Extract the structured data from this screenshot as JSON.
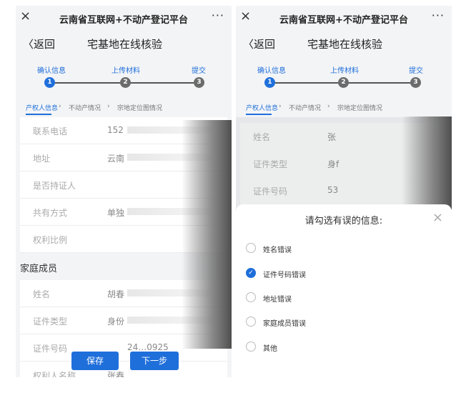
{
  "app": {
    "title": "云南省互联网+不动产登记平台",
    "close_icon": "×",
    "more_icon": "···"
  },
  "nav": {
    "back": "〈返回",
    "page_title": "宅基地在线核验"
  },
  "steps": [
    {
      "label": "确认信息",
      "num": "1"
    },
    {
      "label": "上传材料",
      "num": "2"
    },
    {
      "label": "提交",
      "num": "3"
    }
  ],
  "subtabs": [
    "产权人信息",
    "不动产情况",
    "宗地定位图情况"
  ],
  "subtab_sep": "›",
  "left_rows": [
    {
      "label": "联系电话",
      "value": "152"
    },
    {
      "label": "地址",
      "value": "云南"
    },
    {
      "label": "是否持证人",
      "value": ""
    },
    {
      "label": "共有方式",
      "value": "单独"
    },
    {
      "label": "权利比例",
      "value": ""
    }
  ],
  "section_family": "家庭成员",
  "family_rows": [
    {
      "label": "姓名",
      "value": "胡春"
    },
    {
      "label": "证件类型",
      "value": "身份"
    },
    {
      "label": "证件号码",
      "value": "24…0925"
    },
    {
      "label": "权利人名称",
      "value": "张春"
    }
  ],
  "buttons": {
    "save": "保存",
    "next": "下一步"
  },
  "right_rows": [
    {
      "label": "姓名",
      "value": "张"
    },
    {
      "label": "证件类型",
      "value": "身f"
    },
    {
      "label": "证件号码",
      "value": "53"
    }
  ],
  "sheet": {
    "title": "请勾选有误的信息:",
    "close": "×",
    "options": [
      {
        "label": "姓名错误",
        "checked": false
      },
      {
        "label": "证件号码错误",
        "checked": true
      },
      {
        "label": "地址错误",
        "checked": false
      },
      {
        "label": "家庭成员错误",
        "checked": false
      },
      {
        "label": "其他",
        "checked": false
      }
    ],
    "check_mark": "✓"
  },
  "colors": {
    "accent": "#1f6fdb",
    "bg": "#f3f4f6"
  }
}
